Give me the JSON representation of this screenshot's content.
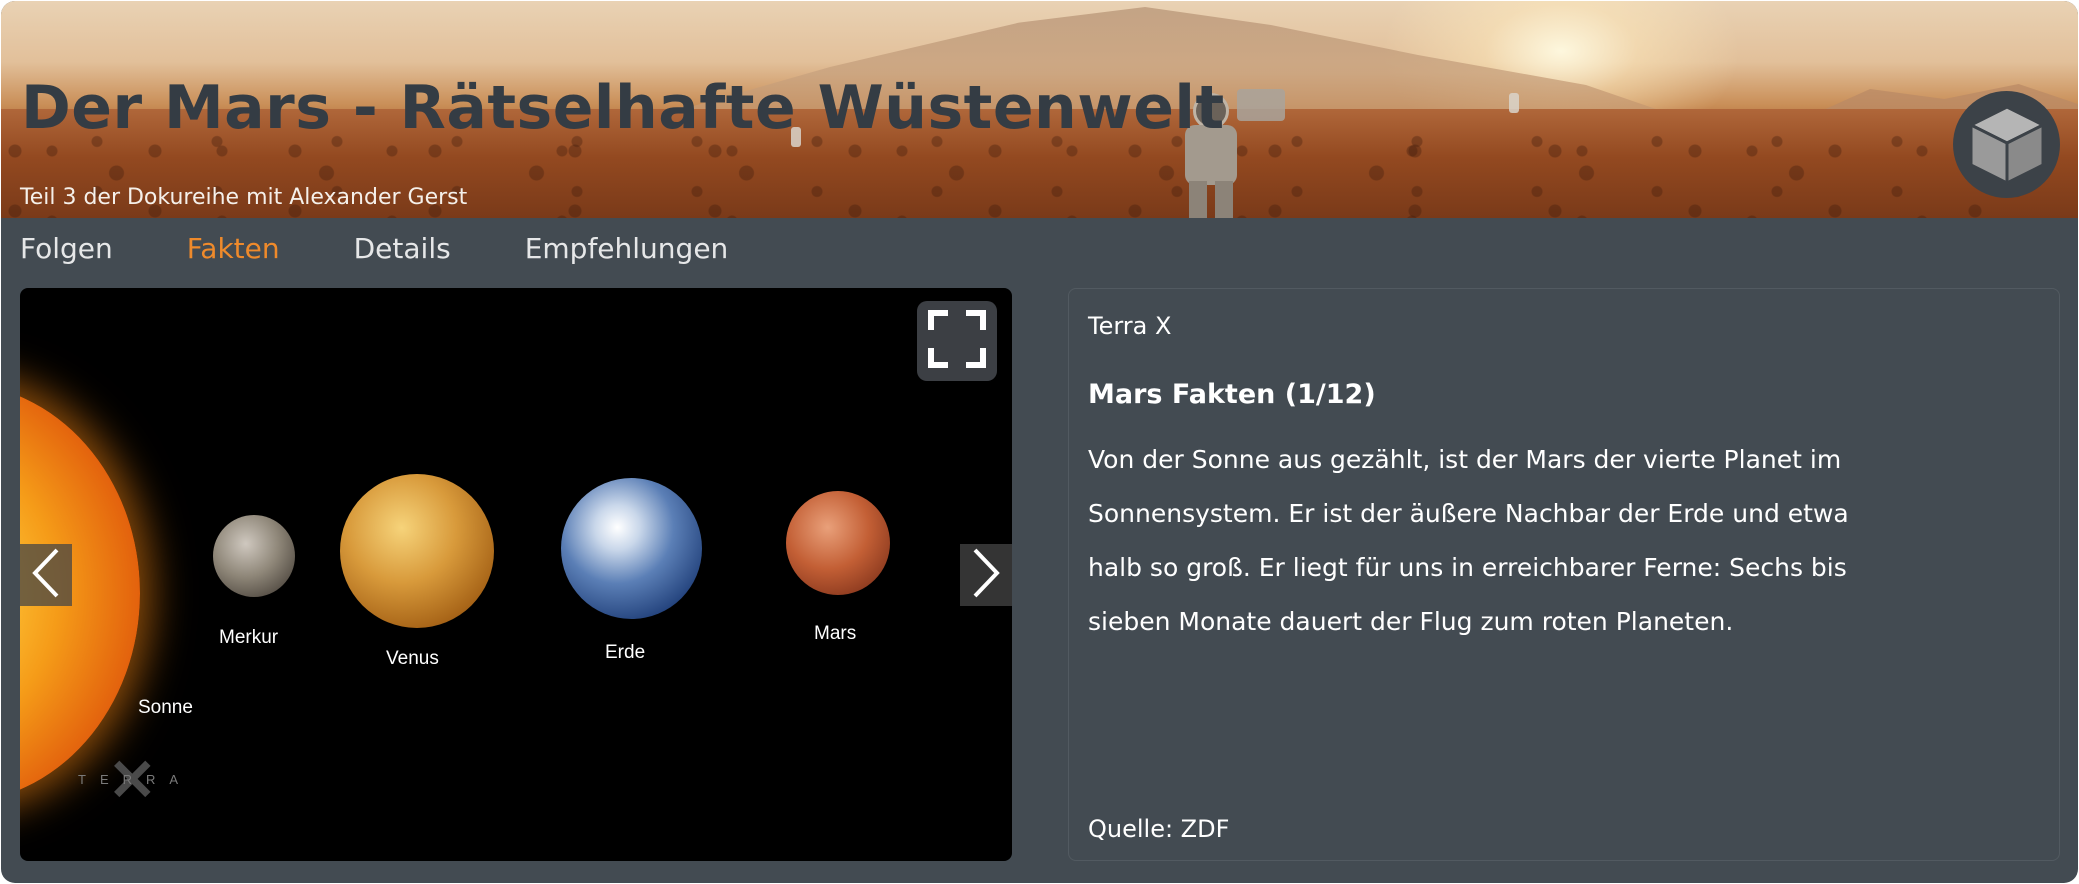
{
  "header": {
    "title": "Der Mars - Rätselhafte Wüstenwelt",
    "subtitle": "Teil 3 der Dokureihe mit Alexander Gerst",
    "badge_icon": "cube-icon"
  },
  "tabs": [
    {
      "label": "Folgen",
      "active": false
    },
    {
      "label": "Fakten",
      "active": true
    },
    {
      "label": "Details",
      "active": false
    },
    {
      "label": "Empfehlungen",
      "active": false
    }
  ],
  "viewer": {
    "labels": {
      "sonne": "Sonne",
      "merkur": "Merkur",
      "venus": "Venus",
      "erde": "Erde",
      "mars": "Mars"
    },
    "watermark": "TERRA",
    "prev_icon": "chevron-left-icon",
    "next_icon": "chevron-right-icon",
    "fullscreen_icon": "fullscreen-icon"
  },
  "facts": {
    "source_top": "Terra X",
    "heading": "Mars Fakten (1/12)",
    "body": "Von der Sonne aus gezählt, ist der Mars der vierte Planet im Sonnensystem. Er ist der äußere Nachbar der Erde und etwa halb so groß. Er liegt für uns in erreichbarer Ferne: Sechs bis sieben Monate dauert der Flug zum roten Planeten.",
    "source_bottom": "Quelle: ZDF"
  },
  "colors": {
    "background": "#434b52",
    "accent": "#ef8a2b",
    "title": "#343c44"
  }
}
